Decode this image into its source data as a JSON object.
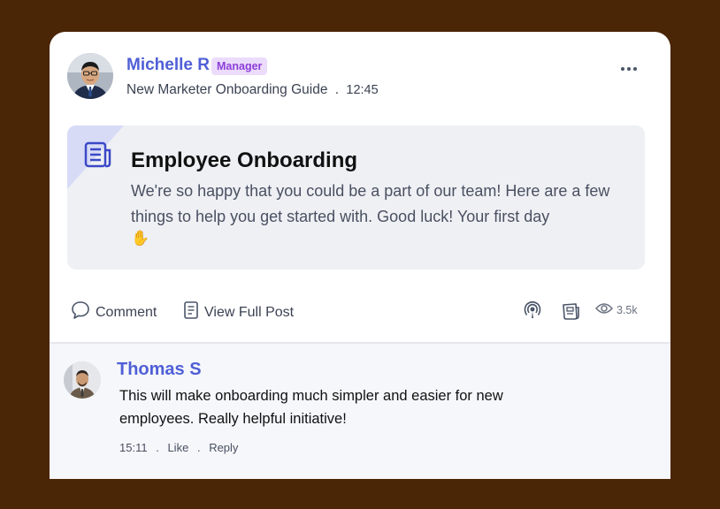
{
  "post": {
    "author": "Michelle R",
    "role_badge": "Manager",
    "context": "New Marketer Onboarding Guide",
    "separator": ".",
    "time": "12:45",
    "title": "Employee Onboarding",
    "body": "We're so happy that you could be a part of our team! Here are a few things to help you get started with. Good luck! Your first day",
    "emoji": "✋"
  },
  "actions": {
    "comment_label": "Comment",
    "view_full_post_label": "View Full Post",
    "views_count": "3.5k"
  },
  "icons": {
    "more": "more-horizontal-icon",
    "doc": "document-icon",
    "comment": "comment-bubble-icon",
    "view": "document-outline-icon",
    "podcast": "podcast-icon",
    "news": "newspaper-icon",
    "views": "eye-icon"
  },
  "comment": {
    "author": "Thomas S",
    "text": "This will make onboarding much simpler and easier for new employees. Really helpful initiative!",
    "time": "15:11",
    "separator": ".",
    "like_label": "Like",
    "reply_label": "Reply"
  },
  "colors": {
    "background": "#4a2506",
    "accent": "#4f5fd6",
    "badge_bg": "#ecdcfb",
    "badge_text": "#8b3fd9",
    "post_box_bg": "#eef0f4"
  }
}
